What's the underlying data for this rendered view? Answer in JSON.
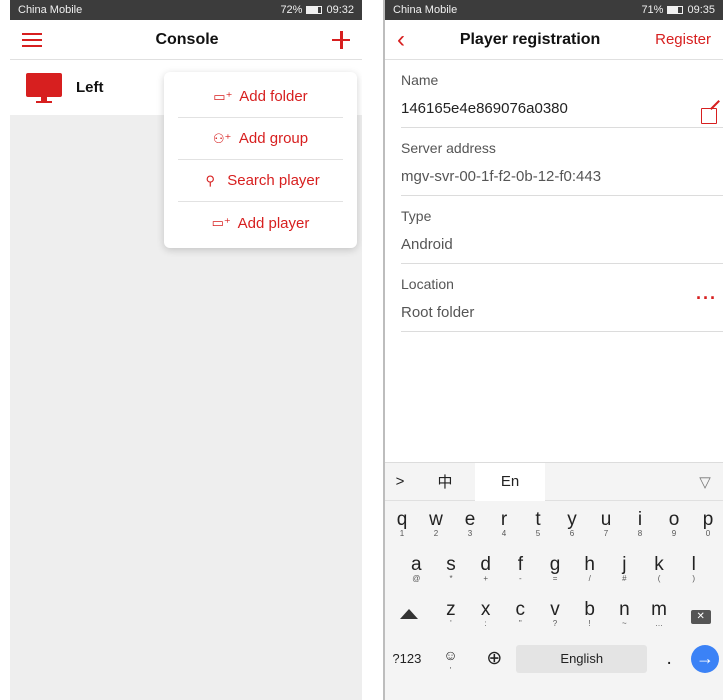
{
  "left_screen": {
    "status_bar": {
      "carrier": "China Mobile",
      "signal": "⁴ᴳ▂▄▆ ≋",
      "battery": "72%",
      "time": "09:32"
    },
    "navbar": {
      "title": "Console"
    },
    "players": [
      {
        "name": "Left"
      }
    ],
    "menu": {
      "items": [
        {
          "label": "Add folder",
          "icon": "add-folder-icon"
        },
        {
          "label": "Add group",
          "icon": "add-group-icon"
        },
        {
          "label": "Search player",
          "icon": "search-icon"
        },
        {
          "label": "Add player",
          "icon": "add-player-icon"
        }
      ]
    }
  },
  "right_screen": {
    "status_bar": {
      "carrier": "China Mobile",
      "signal": "⁴ᴳ▂▄▆ ≋",
      "battery": "71%",
      "time": "09:35"
    },
    "navbar": {
      "title": "Player registration",
      "action": "Register"
    },
    "fields": {
      "name": {
        "label": "Name",
        "value": "146165e4e869076a0380"
      },
      "server": {
        "label": "Server address",
        "value": "mgv-svr-00-1f-f2-0b-12-f0:443"
      },
      "type": {
        "label": "Type",
        "value": "Android"
      },
      "location": {
        "label": "Location",
        "value": "Root folder"
      }
    },
    "keyboard": {
      "toolbar": {
        "expand": ">",
        "chinese": "中",
        "english": "En",
        "hide": "▽"
      },
      "row1": [
        {
          "k": "q",
          "s": "1"
        },
        {
          "k": "w",
          "s": "2"
        },
        {
          "k": "e",
          "s": "3"
        },
        {
          "k": "r",
          "s": "4"
        },
        {
          "k": "t",
          "s": "5"
        },
        {
          "k": "y",
          "s": "6"
        },
        {
          "k": "u",
          "s": "7"
        },
        {
          "k": "i",
          "s": "8"
        },
        {
          "k": "o",
          "s": "9"
        },
        {
          "k": "p",
          "s": "0"
        }
      ],
      "row2": [
        {
          "k": "a",
          "s": "@"
        },
        {
          "k": "s",
          "s": "*"
        },
        {
          "k": "d",
          "s": "+"
        },
        {
          "k": "f",
          "s": "-"
        },
        {
          "k": "g",
          "s": "="
        },
        {
          "k": "h",
          "s": "/"
        },
        {
          "k": "j",
          "s": "#"
        },
        {
          "k": "k",
          "s": "("
        },
        {
          "k": "l",
          "s": ")"
        }
      ],
      "row3": [
        {
          "k": "z",
          "s": "'"
        },
        {
          "k": "x",
          "s": ":"
        },
        {
          "k": "c",
          "s": "\""
        },
        {
          "k": "v",
          "s": "?"
        },
        {
          "k": "b",
          "s": "!"
        },
        {
          "k": "n",
          "s": "~"
        },
        {
          "k": "m",
          "s": "…"
        }
      ],
      "bottom": {
        "symbols": "?123",
        "emoji": "☺",
        "comma": ",",
        "globe": "⊕",
        "space": "English",
        "period": ".",
        "enter": "→"
      }
    }
  },
  "colors": {
    "accent": "#d71f1f",
    "status_bar": "#3c3c3c",
    "enter_key": "#3b82f6"
  }
}
